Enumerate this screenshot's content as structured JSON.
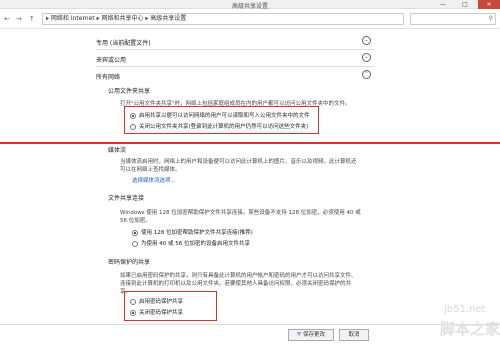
{
  "window": {
    "title": "高级共享设置",
    "minimize": "—",
    "maximize": "□",
    "close": "✕"
  },
  "addressbar": {
    "back": "←",
    "forward": "→",
    "up": "↑",
    "path": "▸  网络和 Internet  ▸  网络和共享中心  ▸  高级共享设置",
    "search_icon": "⚲"
  },
  "profiles": {
    "private": "专用 (当前配置文件)",
    "guest": "来宾或公用",
    "all": "所有网络"
  },
  "public_folder": {
    "title": "公用文件夹共享",
    "description": "打开\"公用文件夹共享\"时，网络上包括家庭组成员在内的用户都可以访问公用文件夹中的文件。",
    "options": [
      "启用共享以便可以访问网络的用户可以读取和写入公用文件夹中的文件",
      "关闭公用文件夹共享(登录到此计算机的用户仍然可以访问这些文件夹)"
    ]
  },
  "media": {
    "title": "媒体流",
    "description1": "当媒体流启用时，网络上的用户和设备便可以访问此计算机上的图片、音乐以及视频。此计算机还",
    "description2": "可以在网络上查找媒体。",
    "link": "选择媒体流选项..."
  },
  "file_sharing": {
    "title": "文件共享连接",
    "description1": "Windows 使用 128 位加密帮助保护文件共享连接。某些设备不支持 128 位加密，必须使用 40 或",
    "description2": "56 位加密。",
    "options": [
      "使用 128 位加密帮助保护文件共享连接(推荐)",
      "为使用 40 或 56 位加密的设备启用文件共享"
    ]
  },
  "password": {
    "title": "密码保护的共享",
    "description1": "如果已启用密码保护的共享，则只有具备此计算机的用户帐户和密码的用户才可以访问共享文件、",
    "description2": "连接到此计算机的打印机以及公用文件夹。若要使其他人具备访问权限，必须关闭密码保护的共",
    "description3": "享。",
    "options": [
      "启用密码保护共享",
      "关闭密码保护共享"
    ]
  },
  "footer": {
    "save": "保存更改",
    "cancel": "取消"
  },
  "watermark": {
    "site": "jb51.net",
    "brand": "脚本之家"
  },
  "colors": {
    "highlight": "#d9322b",
    "link": "#1a5fb4"
  }
}
